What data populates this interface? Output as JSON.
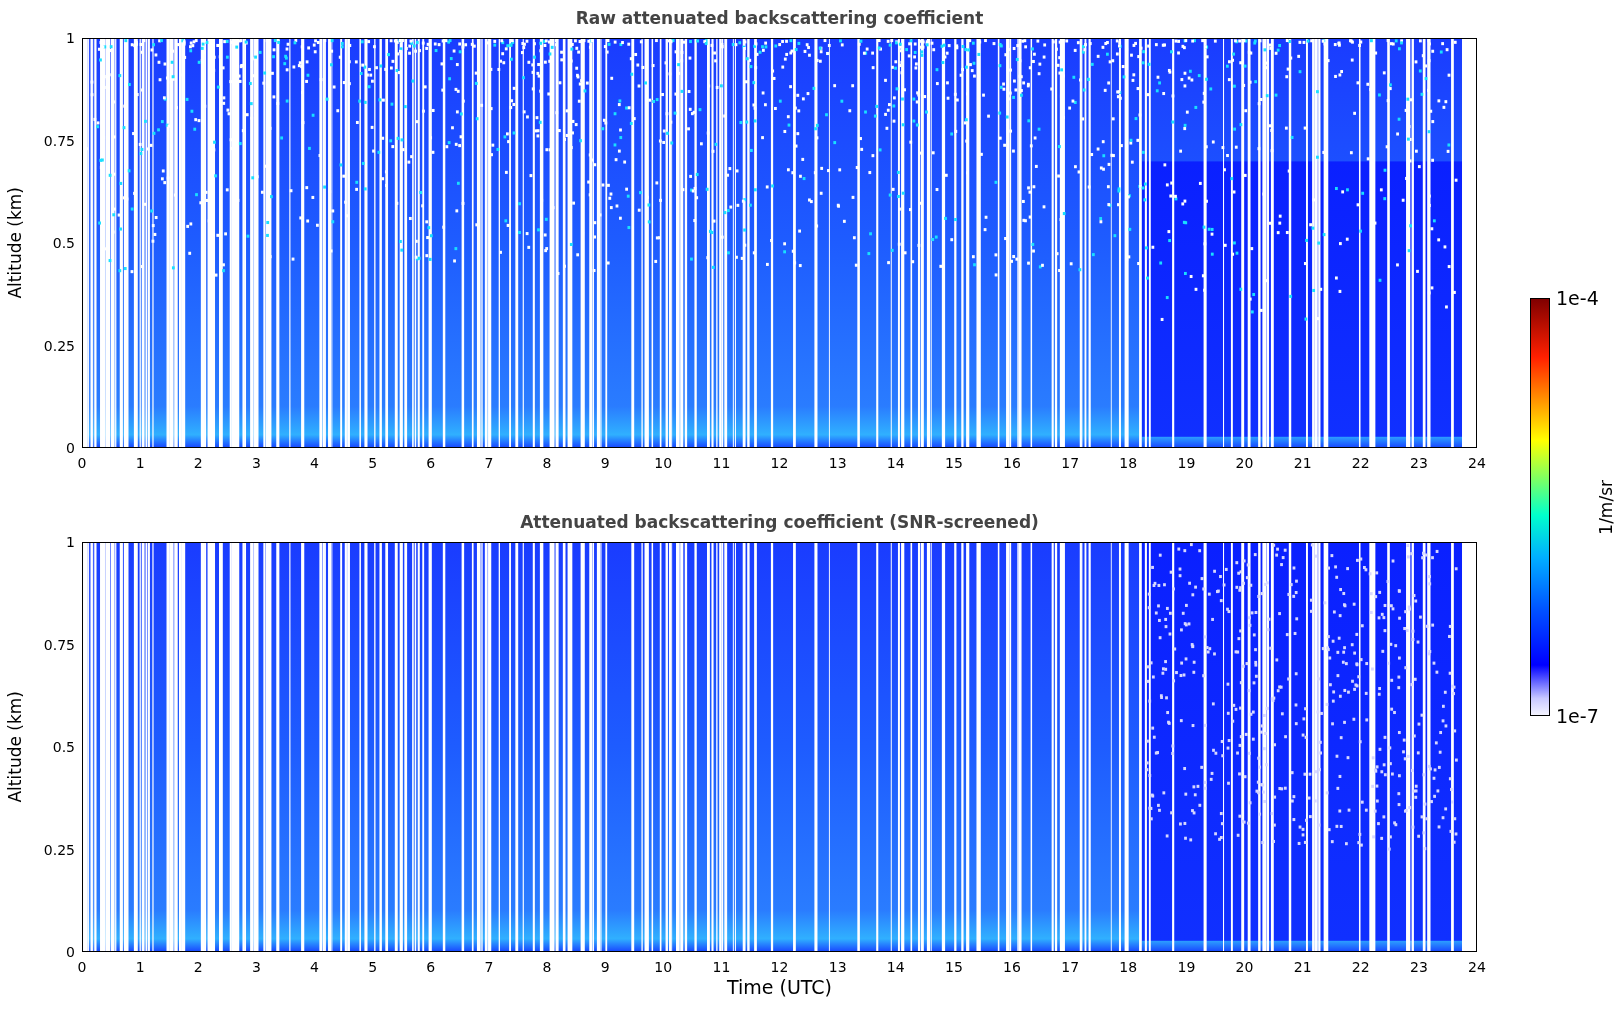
{
  "panels": [
    {
      "kind": "raw",
      "title": "Raw attenuated backscattering coefficient",
      "ylabel": "Altitude (km)",
      "yticks": [
        "1",
        "0.75",
        "0.5",
        "0.25",
        "0"
      ],
      "xticks": [
        "0",
        "1",
        "2",
        "3",
        "4",
        "5",
        "6",
        "7",
        "8",
        "9",
        "10",
        "11",
        "12",
        "13",
        "14",
        "15",
        "16",
        "17",
        "18",
        "19",
        "20",
        "21",
        "22",
        "23",
        "24"
      ]
    },
    {
      "kind": "screened",
      "title": "Attenuated backscattering coefficient (SNR-screened)",
      "ylabel": "Altitude (km)",
      "yticks": [
        "1",
        "0.75",
        "0.5",
        "0.25",
        "0"
      ],
      "xticks": [
        "0",
        "1",
        "2",
        "3",
        "4",
        "5",
        "6",
        "7",
        "8",
        "9",
        "10",
        "11",
        "12",
        "13",
        "14",
        "15",
        "16",
        "17",
        "18",
        "19",
        "20",
        "21",
        "22",
        "23",
        "24"
      ],
      "xlabel": "Time (UTC)"
    }
  ],
  "colorbar": {
    "label": "1/m/sr",
    "ticks": [
      "1e-4",
      "1e-7"
    ]
  }
}
